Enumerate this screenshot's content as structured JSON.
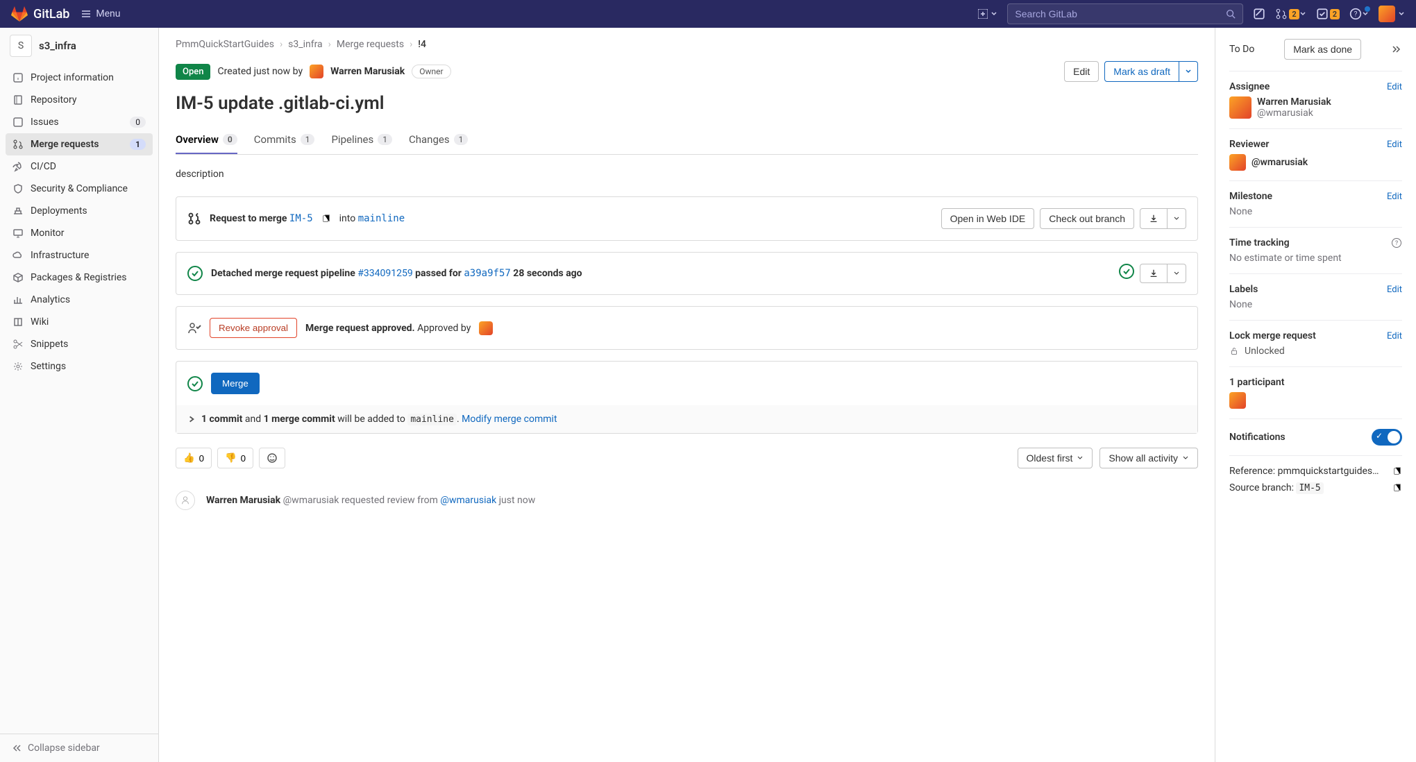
{
  "topbar": {
    "brand": "GitLab",
    "menu": "Menu",
    "search_placeholder": "Search GitLab",
    "mr_badge": "2",
    "todo_badge": "2"
  },
  "sidebar": {
    "project_initial": "S",
    "project_name": "s3_infra",
    "items": [
      {
        "label": "Project information"
      },
      {
        "label": "Repository"
      },
      {
        "label": "Issues",
        "badge": "0"
      },
      {
        "label": "Merge requests",
        "badge": "1"
      },
      {
        "label": "CI/CD"
      },
      {
        "label": "Security & Compliance"
      },
      {
        "label": "Deployments"
      },
      {
        "label": "Monitor"
      },
      {
        "label": "Infrastructure"
      },
      {
        "label": "Packages & Registries"
      },
      {
        "label": "Analytics"
      },
      {
        "label": "Wiki"
      },
      {
        "label": "Snippets"
      },
      {
        "label": "Settings"
      }
    ],
    "collapse": "Collapse sidebar"
  },
  "breadcrumbs": {
    "a": "PmmQuickStartGuides",
    "b": "s3_infra",
    "c": "Merge requests",
    "d": "!4"
  },
  "mr": {
    "status": "Open",
    "created": "Created just now by",
    "author": "Warren Marusiak",
    "owner": "Owner",
    "edit": "Edit",
    "mark_draft": "Mark as draft",
    "title": "IM-5 update .gitlab-ci.yml"
  },
  "tabs": {
    "overview": "Overview",
    "overview_c": "0",
    "commits": "Commits",
    "commits_c": "1",
    "pipelines": "Pipelines",
    "pipelines_c": "1",
    "changes": "Changes",
    "changes_c": "1"
  },
  "description": "description",
  "merge_widget": {
    "request": "Request to merge",
    "source_branch": "IM-5",
    "into": "into",
    "target_branch": "mainline",
    "open_ide": "Open in Web IDE",
    "checkout": "Check out branch"
  },
  "pipeline": {
    "prefix": "Detached merge request pipeline",
    "id": "#334091259",
    "mid": "passed for",
    "sha": "a39a9f57",
    "suffix": "28 seconds ago"
  },
  "approval": {
    "revoke": "Revoke approval",
    "approved": "Merge request approved.",
    "by": "Approved by"
  },
  "merge_action": {
    "merge": "Merge",
    "commit_pre": "1 commit",
    "commit_mid": "and",
    "merge_commit": "1 merge commit",
    "commit_post": "will be added to",
    "target": "mainline",
    "modify": "Modify merge commit"
  },
  "reactions": {
    "up": "0",
    "down": "0",
    "sort": "Oldest first",
    "filter": "Show all activity"
  },
  "timeline": {
    "author": "Warren Marusiak",
    "handle": "@wmarusiak",
    "text1": "requested review from",
    "reviewer": "@wmarusiak",
    "time": "just now"
  },
  "rightbar": {
    "todo": "To Do",
    "mark_done": "Mark as done",
    "assignee": "Assignee",
    "assignee_name": "Warren Marusiak",
    "assignee_handle": "@wmarusiak",
    "reviewer": "Reviewer",
    "reviewer_handle": "@wmarusiak",
    "milestone": "Milestone",
    "none": "None",
    "time_tracking": "Time tracking",
    "time_value": "No estimate or time spent",
    "labels": "Labels",
    "lock": "Lock merge request",
    "unlocked": "Unlocked",
    "participants": "1 participant",
    "notifications": "Notifications",
    "reference_label": "Reference:",
    "reference": "pmmquickstartguides…",
    "source_label": "Source branch:",
    "source": "IM-5",
    "edit": "Edit"
  }
}
